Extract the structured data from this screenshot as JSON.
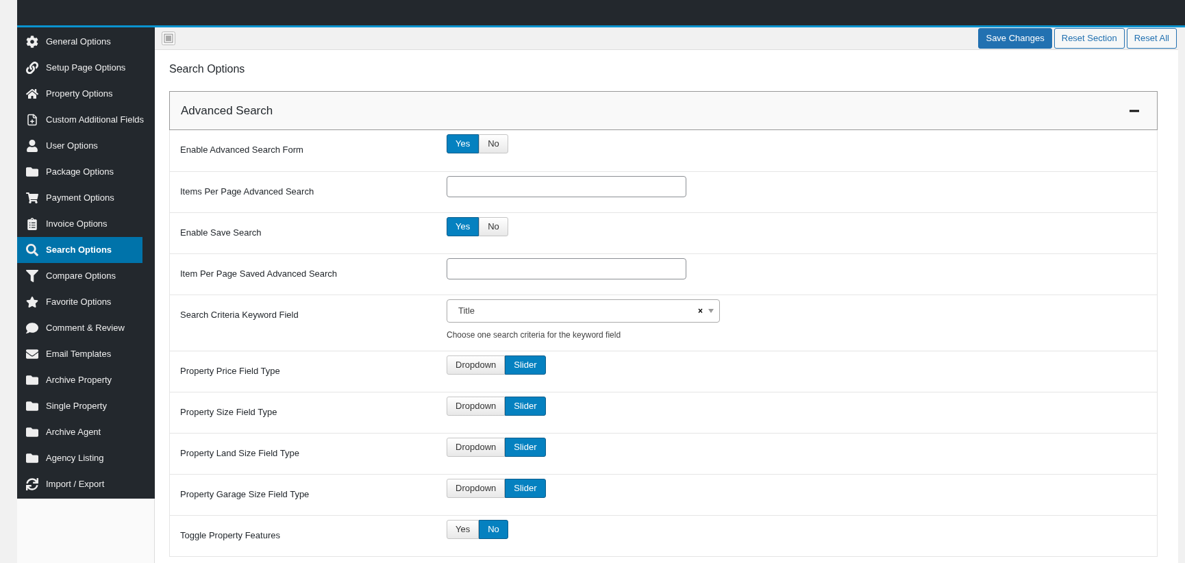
{
  "sidebar": {
    "items": [
      {
        "label": "General Options",
        "selected": false
      },
      {
        "label": "Setup Page Options",
        "selected": false
      },
      {
        "label": "Property Options",
        "selected": false
      },
      {
        "label": "Custom Additional Fields",
        "selected": false
      },
      {
        "label": "User Options",
        "selected": false
      },
      {
        "label": "Package Options",
        "selected": false
      },
      {
        "label": "Payment Options",
        "selected": false
      },
      {
        "label": "Invoice Options",
        "selected": false
      },
      {
        "label": "Search Options",
        "selected": true
      },
      {
        "label": "Compare Options",
        "selected": false
      },
      {
        "label": "Favorite Options",
        "selected": false
      },
      {
        "label": "Comment & Review",
        "selected": false
      },
      {
        "label": "Email Templates",
        "selected": false
      },
      {
        "label": "Archive Property",
        "selected": false
      },
      {
        "label": "Single Property",
        "selected": false
      },
      {
        "label": "Archive Agent",
        "selected": false
      },
      {
        "label": "Agency Listing",
        "selected": false
      },
      {
        "label": "Import / Export",
        "selected": false
      }
    ]
  },
  "toolbar": {
    "buttons": [
      {
        "label": "Save Changes",
        "kind": "primary"
      },
      {
        "label": "Reset Section",
        "kind": "secondary"
      },
      {
        "label": "Reset All",
        "kind": "secondary"
      }
    ]
  },
  "page_title": "Search Options",
  "section": {
    "title": "Advanced Search",
    "expanded": true,
    "rows": [
      {
        "label": "Enable Advanced Search Form",
        "kind": "toggle",
        "options": [
          {
            "label": "Yes",
            "selected": true
          },
          {
            "label": "No",
            "selected": false
          }
        ]
      },
      {
        "label": "Items Per Page Advanced Search",
        "kind": "text"
      },
      {
        "label": "Enable Save Search",
        "kind": "toggle",
        "options": [
          {
            "label": "Yes",
            "selected": true
          },
          {
            "label": "No",
            "selected": false
          }
        ]
      },
      {
        "label": "Item Per Page Saved Advanced Search",
        "kind": "text"
      },
      {
        "label": "Search Criteria Keyword Field",
        "kind": "select",
        "value": "Title",
        "clear": "×",
        "hint": "Choose one search criteria for the keyword field"
      },
      {
        "label": "Property Price Field Type",
        "kind": "toggle",
        "options": [
          {
            "label": "Dropdown",
            "selected": false
          },
          {
            "label": "Slider",
            "selected": true
          }
        ]
      },
      {
        "label": "Property Size Field Type",
        "kind": "toggle",
        "options": [
          {
            "label": "Dropdown",
            "selected": false
          },
          {
            "label": "Slider",
            "selected": true
          }
        ]
      },
      {
        "label": "Property Land Size Field Type",
        "kind": "toggle",
        "options": [
          {
            "label": "Dropdown",
            "selected": false
          },
          {
            "label": "Slider",
            "selected": true
          }
        ]
      },
      {
        "label": "Property Garage Size Field Type",
        "kind": "toggle",
        "options": [
          {
            "label": "Dropdown",
            "selected": false
          },
          {
            "label": "Slider",
            "selected": true
          }
        ]
      },
      {
        "label": "Toggle Property Features",
        "kind": "toggle",
        "options": [
          {
            "label": "Yes",
            "selected": false
          },
          {
            "label": "No",
            "selected": true
          }
        ]
      }
    ]
  }
}
